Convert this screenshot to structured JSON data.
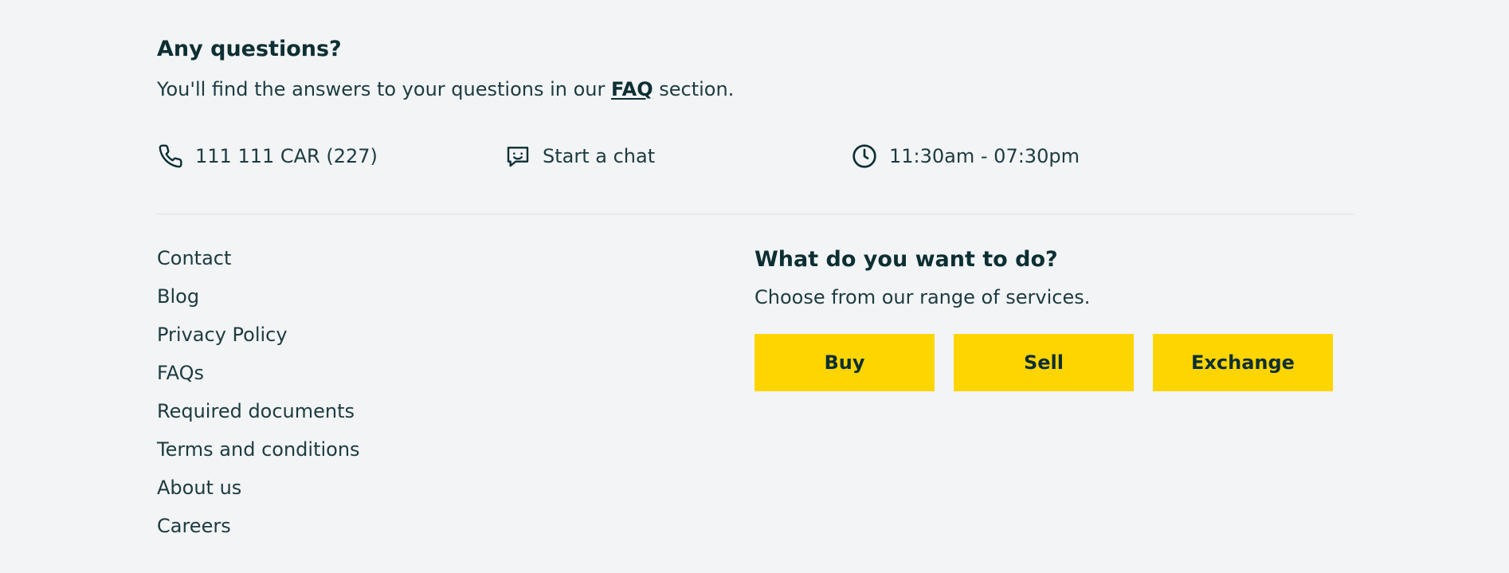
{
  "questions": {
    "title": "Any questions?",
    "text_before": "You'll find the answers to your questions in our ",
    "faq_link": "FAQ",
    "text_after": " section."
  },
  "contact": {
    "phone": {
      "icon": "phone-icon",
      "label": "111 111 CAR (227)"
    },
    "chat": {
      "icon": "chat-icon",
      "label": "Start a chat"
    },
    "hours": {
      "icon": "clock-icon",
      "label": "11:30am - 07:30pm"
    }
  },
  "footer_links": [
    "Contact",
    "Blog",
    "Privacy Policy",
    "FAQs",
    "Required documents",
    "Terms and conditions",
    "About us",
    "Careers"
  ],
  "services": {
    "title": "What do you want to do?",
    "subtitle": "Choose from our range of services.",
    "buttons": [
      "Buy",
      "Sell",
      "Exchange"
    ]
  },
  "colors": {
    "background": "#f2f4f6",
    "text_dark": "#0d2f33",
    "accent_yellow": "#ffd500",
    "divider": "#dde2e6"
  }
}
